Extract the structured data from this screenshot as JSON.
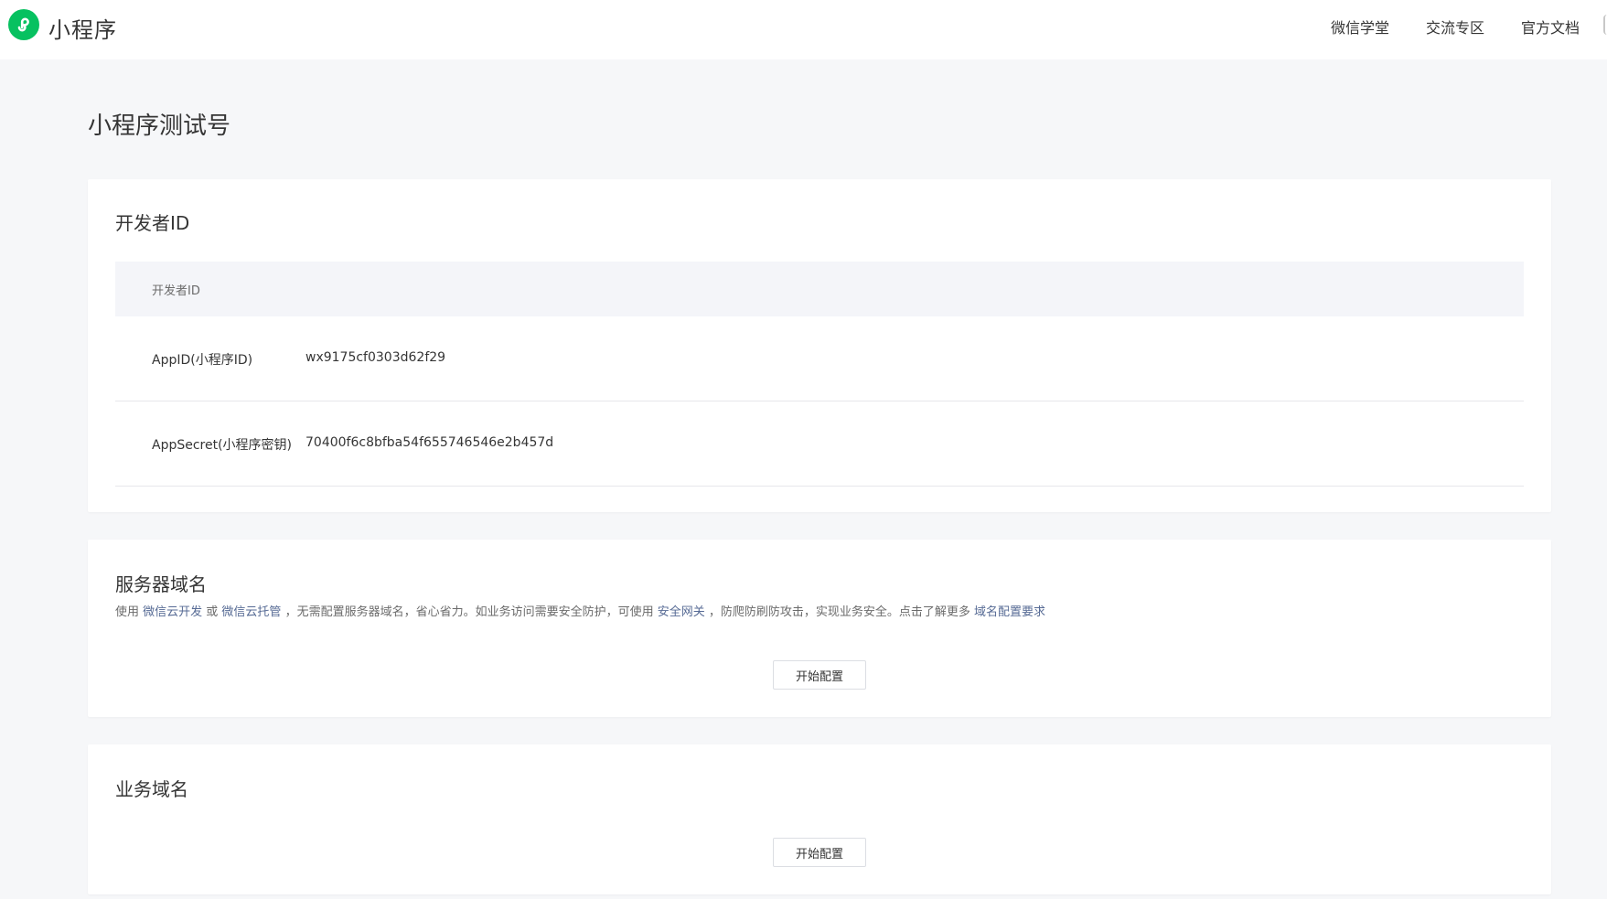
{
  "header": {
    "brand": "小程序",
    "logo_icon": "mini-program-logo-icon",
    "nav": [
      "微信学堂",
      "交流专区",
      "官方文档"
    ]
  },
  "page_title": "小程序测试号",
  "developer_id": {
    "title": "开发者ID",
    "table_header": "开发者ID",
    "rows": [
      {
        "label": "AppID(小程序ID)",
        "value": "wx9175cf0303d62f29"
      },
      {
        "label": "AppSecret(小程序密钥)",
        "value": "70400f6c8bfba54f655746546e2b457d"
      }
    ]
  },
  "server_domain": {
    "title": "服务器域名",
    "desc": {
      "t1": "使用 ",
      "link1": "微信云开发",
      "t2": " 或 ",
      "link2": "微信云托管",
      "t3": " ，无需配置服务器域名，省心省力。如业务访问需要安全防护，可使用 ",
      "link3": "安全网关",
      "t4": " ，防爬防刷防攻击，实现业务安全。点击了解更多 ",
      "link4": "域名配置要求"
    },
    "button": "开始配置"
  },
  "business_domain": {
    "title": "业务域名",
    "button": "开始配置"
  },
  "colors": {
    "brand_green": "#07c160",
    "link": "#576b95",
    "background": "#f6f7f9"
  }
}
